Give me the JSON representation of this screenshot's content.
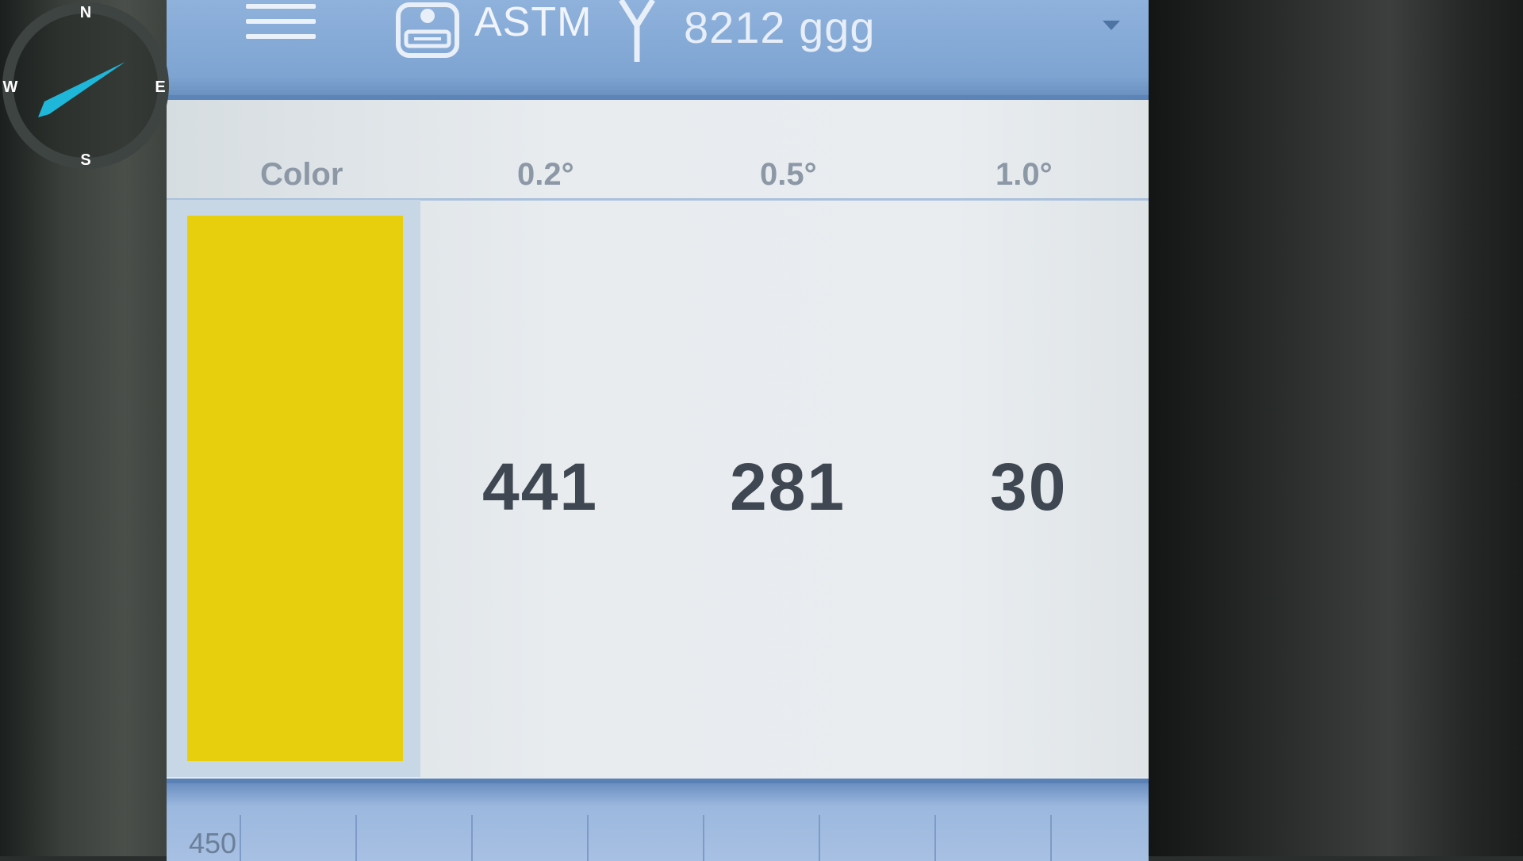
{
  "header": {
    "app_title": "ASTM",
    "sample_id": "8212 ggg"
  },
  "table": {
    "columns": [
      "Color",
      "0.2°",
      "0.5°",
      "1.0°"
    ],
    "row": {
      "swatch_color": "#e7cf0d",
      "values": [
        "441",
        "281",
        "30"
      ]
    }
  },
  "chart_strip": {
    "axis_label": "450"
  },
  "compass": {
    "north": "N",
    "east": "E",
    "south": "S",
    "west": "W",
    "needle_color": "#1fb7d9"
  },
  "colors": {
    "header_blue": "#7ea4d2",
    "value_text": "#3f4752"
  }
}
